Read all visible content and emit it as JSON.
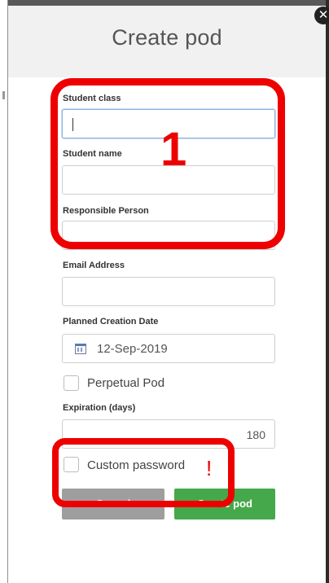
{
  "dialog": {
    "title": "Create pod",
    "close_symbol": "✕"
  },
  "form": {
    "student_class_label": "Student class",
    "student_class_value": "",
    "student_name_label": "Student name",
    "student_name_value": "",
    "responsible_person_label": "Responsible Person",
    "responsible_person_value": "",
    "email_label": "Email Address",
    "email_value": "",
    "planned_date_label": "Planned Creation Date",
    "planned_date_value": "12-Sep-2019",
    "perpetual_label": "Perpetual Pod",
    "perpetual_checked": false,
    "expiration_label": "Expiration (days)",
    "expiration_value": "180",
    "custom_password_label": "Custom password",
    "custom_password_checked": false
  },
  "buttons": {
    "cancel": "Cancel",
    "create": "Create pod"
  },
  "annotations": {
    "marker_1": "1",
    "marker_2": "!",
    "color": "#ee0000"
  },
  "icons": {
    "close": "close-icon",
    "calendar": "calendar-icon"
  }
}
